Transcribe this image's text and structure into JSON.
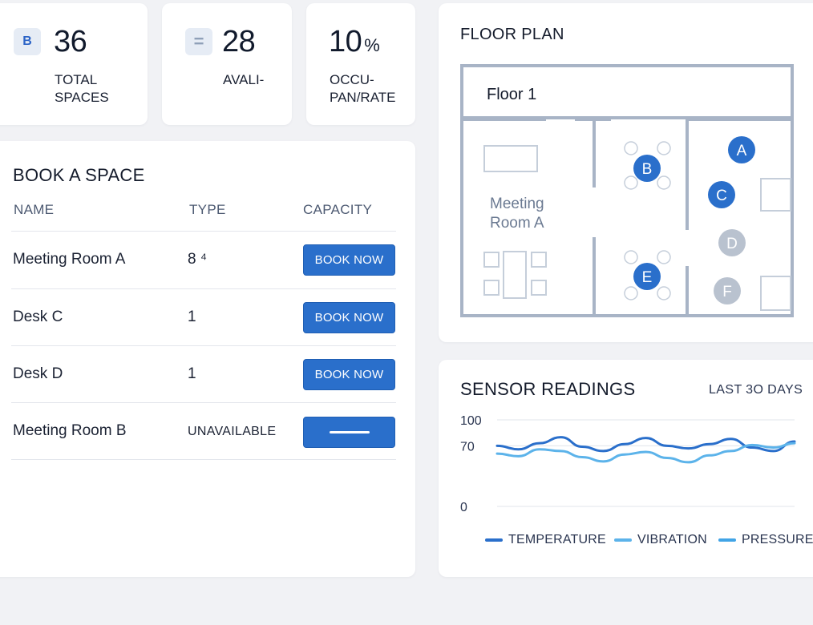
{
  "stats": [
    {
      "icon": "B",
      "icon_name": "spaces-icon",
      "value": "36",
      "unit": "",
      "label": "TOTAL\nSPACES"
    },
    {
      "icon": "=",
      "icon_name": "equals-icon",
      "value": "28",
      "unit": "",
      "label": "AVALI-"
    },
    {
      "icon": "",
      "icon_name": "",
      "value": "10",
      "unit": "%",
      "label": "OCCU-\nPAN/RATE"
    }
  ],
  "booking": {
    "title": "BOOK A SPACE",
    "columns": [
      "NAME",
      "TYPE",
      "CAPACITY"
    ],
    "rows": [
      {
        "name": "Meeting Room A",
        "type": "8 ⁴",
        "action": "BOOK NOW"
      },
      {
        "name": "Desk C",
        "type": "1",
        "action": "BOOK NOW"
      },
      {
        "name": "Desk D",
        "type": "1",
        "action": "BOOK NOW"
      },
      {
        "name": "Meeting Room B",
        "type": "UNAVAILABLE",
        "action": ""
      }
    ]
  },
  "floor_plan": {
    "title": "FLOOR PLAN",
    "floor_label": "Floor 1",
    "room_label_1": "Meeting",
    "room_label_2": "Room A",
    "markers": [
      {
        "label": "A",
        "status": "available"
      },
      {
        "label": "B",
        "status": "available"
      },
      {
        "label": "C",
        "status": "available"
      },
      {
        "label": "D",
        "status": "unavailable"
      },
      {
        "label": "E",
        "status": "available"
      },
      {
        "label": "F",
        "status": "unavailable"
      }
    ]
  },
  "sensors": {
    "title": "SENSOR READINGS",
    "period": "LAST 3O DAYS",
    "legend": [
      "TEMPERATURE",
      "VIBRATION",
      "PRESSURE"
    ],
    "colors": {
      "temperature": "#2a6fcb",
      "vibration": "#5cb3ea",
      "pressure": "#41a4e6"
    }
  },
  "chart_data": {
    "type": "line",
    "title": "SENSOR READINGS",
    "ylim": [
      0,
      100
    ],
    "yticks": [
      "100",
      "70",
      "0"
    ],
    "grid": true,
    "legend_position": "bottom",
    "series": [
      {
        "name": "TEMPERATURE",
        "values": [
          70,
          66,
          73,
          80,
          69,
          64,
          72,
          79,
          70,
          67,
          72,
          78,
          68,
          64,
          75
        ]
      },
      {
        "name": "VIBRATION",
        "values": [
          61,
          58,
          66,
          64,
          57,
          52,
          60,
          63,
          56,
          51,
          59,
          64,
          71,
          68,
          73
        ]
      }
    ]
  }
}
